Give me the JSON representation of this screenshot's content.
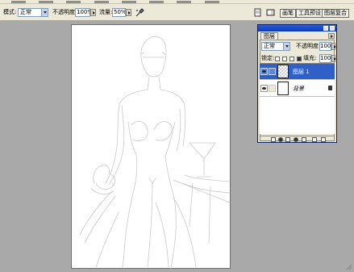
{
  "options_bar": {
    "mode_label": "模式:",
    "mode_value": "正常",
    "opacity_label": "不透明度:",
    "opacity_value": "100%",
    "flow_label": "流量:",
    "flow_value": "50%"
  },
  "palette_well": {
    "tabs": [
      "画笔",
      "工具预设",
      "图层复合"
    ]
  },
  "layers_panel": {
    "tab_label": "图层",
    "blend_mode": "正常",
    "opacity_label": "不透明度:",
    "opacity_value": "100%",
    "lock_label": "锁定:",
    "fill_label": "填充:",
    "fill_value": "100%",
    "layers": [
      {
        "name": "图层 1",
        "selected": true,
        "visible": true
      },
      {
        "name": "背景",
        "selected": false,
        "visible": true,
        "locked": true
      }
    ]
  },
  "icons": {
    "airbrush": "airbrush-icon",
    "close": "close-icon",
    "minimize": "minimize-icon",
    "eye": "eye-icon",
    "brush": "brush-icon",
    "lock": "lock-icon",
    "link": "link-icon",
    "trash": "trash-icon",
    "new_layer": "new-layer-icon"
  },
  "colors": {
    "selection": "#2f5fc9",
    "title_bar": "#0a3bb8",
    "workspace": "#a9a9a9"
  }
}
